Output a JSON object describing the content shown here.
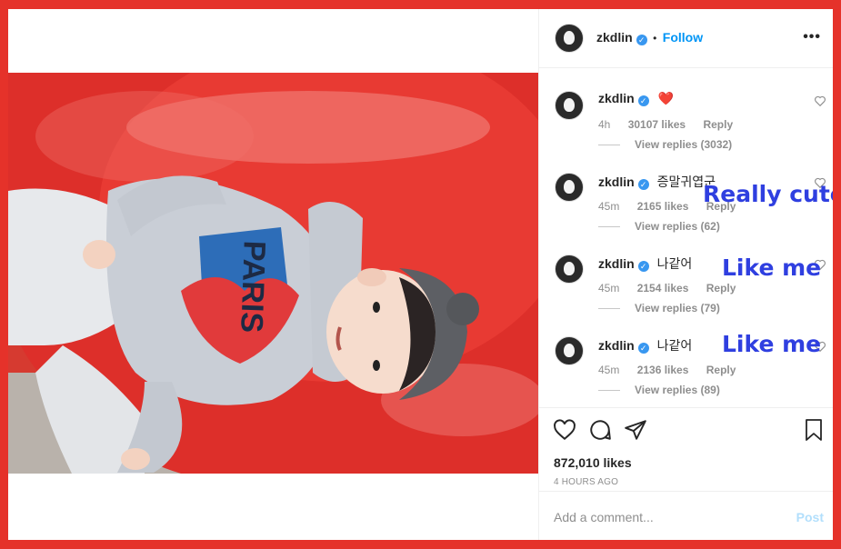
{
  "post": {
    "author": "zkdlin",
    "follow_label": "Follow",
    "separator": "•",
    "more_label": "•••",
    "likes": "872,010 likes",
    "timestamp": "4 HOURS AGO"
  },
  "comments": [
    {
      "user": "zkdlin",
      "text": "❤️",
      "age": "4h",
      "likes": "30107 likes",
      "reply": "Reply",
      "view_replies": "View replies (3032)"
    },
    {
      "user": "zkdlin",
      "text": "증말귀엽군",
      "age": "45m",
      "likes": "2165 likes",
      "reply": "Reply",
      "view_replies": "View replies (62)"
    },
    {
      "user": "zkdlin",
      "text": "나같어",
      "age": "45m",
      "likes": "2154 likes",
      "reply": "Reply",
      "view_replies": "View replies (79)"
    },
    {
      "user": "zkdlin",
      "text": "나같어",
      "age": "45m",
      "likes": "2136 likes",
      "reply": "Reply",
      "view_replies": "View replies (89)"
    }
  ],
  "annotations": [
    "Really cute",
    "Like me",
    "Like me"
  ],
  "photo": {
    "shirt_text": "PARIS"
  },
  "comment_box": {
    "placeholder": "Add a comment...",
    "post_label": "Post"
  },
  "icons": {
    "like": "heart-icon",
    "comment": "comment-icon",
    "share": "share-icon",
    "save": "bookmark-icon",
    "verified": "verified-badge-icon",
    "more": "more-options-icon"
  },
  "colors": {
    "frame_red": "#e5322a",
    "link_blue": "#0095f6",
    "verified_blue": "#3897f0",
    "annotation_blue": "#2f3fe0",
    "post_disabled": "#b2dffc"
  }
}
